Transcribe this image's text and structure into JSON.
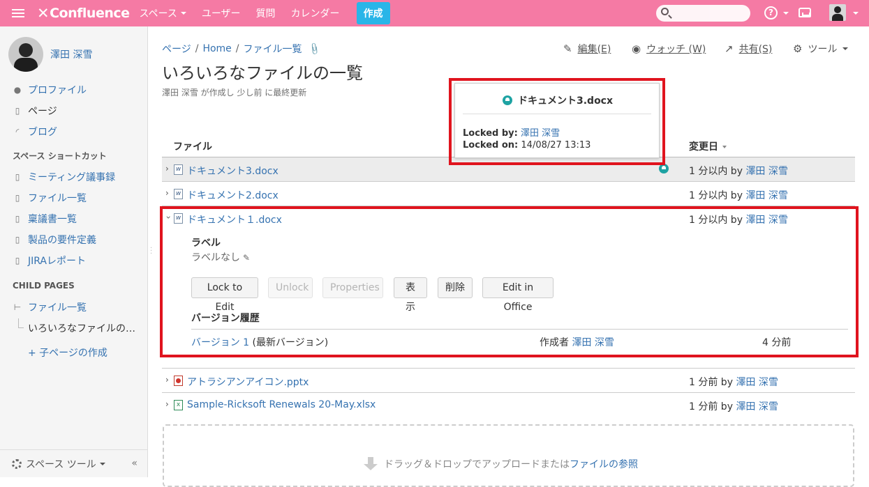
{
  "topbar": {
    "logo": "Confluence",
    "nav": [
      "スペース",
      "ユーザー",
      "質問",
      "カレンダー"
    ],
    "create_label": "作成",
    "search_placeholder": ""
  },
  "sidebar": {
    "user_name": "澤田 深雪",
    "links": [
      "プロファイル",
      "ページ",
      "ブログ"
    ],
    "shortcuts_heading": "スペース ショートカット",
    "shortcuts": [
      "ミーティング議事録",
      "ファイル一覧",
      "稟議書一覧",
      "製品の要件定義",
      "JIRAレポート"
    ],
    "child_pages_heading": "CHILD PAGES",
    "child_parent": "ファイル一覧",
    "child_current": "いろいろなファイルの…",
    "add_child": "+ 子ページの作成",
    "space_tools": "スペース ツール",
    "collapse": "«"
  },
  "breadcrumb": [
    "ページ",
    "Home",
    "ファイル一覧"
  ],
  "page_actions": {
    "edit": "編集(E)",
    "watch": "ウォッチ (W)",
    "share": "共有(S)",
    "tools": "ツール"
  },
  "page": {
    "title": "いろいろなファイルの一覧",
    "byline": "澤田 深雪 が作成し 少し前 に最終更新"
  },
  "table": {
    "col_file": "ファイル",
    "col_modified": "変更日",
    "rows": [
      {
        "name": "ドキュメント3.docx",
        "when": "1 分以内 by ",
        "user": "澤田 深雪"
      },
      {
        "name": "ドキュメント2.docx",
        "when": "1 分以内 by ",
        "user": "澤田 深雪"
      },
      {
        "name": "ドキュメント１.docx",
        "when": "1 分以内 by ",
        "user": "澤田 深雪"
      },
      {
        "name": "アトラシアンアイコン.pptx",
        "when": "1 分前 by ",
        "user": "澤田 深雪"
      },
      {
        "name": "Sample-Ricksoft Renewals 20-May.xlsx",
        "when": "1 分前 by ",
        "user": "澤田 深雪"
      }
    ]
  },
  "popup": {
    "title": "ドキュメント3.docx",
    "locked_by_label": "Locked by:",
    "locked_by_value": "澤田 深雪",
    "locked_on_label": "Locked on:",
    "locked_on_value": "14/08/27 13:13"
  },
  "expanded": {
    "label_heading": "ラベル",
    "no_label": "ラベルなし",
    "buttons": [
      "Lock to Edit",
      "Unlock",
      "Properties",
      "表示",
      "削除",
      "Edit in Office"
    ],
    "version_heading": "バージョン履歴",
    "version_link": "バージョン 1",
    "version_suffix": " (最新バージョン)",
    "created_by_label": "作成者 ",
    "created_by_user": "澤田 深雪",
    "version_when": "4 分前"
  },
  "dropzone": {
    "text": "ドラッグ＆ドロップでアップロードまたは ",
    "link": "ファイルの参照"
  },
  "colors": {
    "header": "#f57aa4",
    "create": "#29b5e8",
    "link": "#3572b0",
    "highlight_box": "#e0141e"
  }
}
